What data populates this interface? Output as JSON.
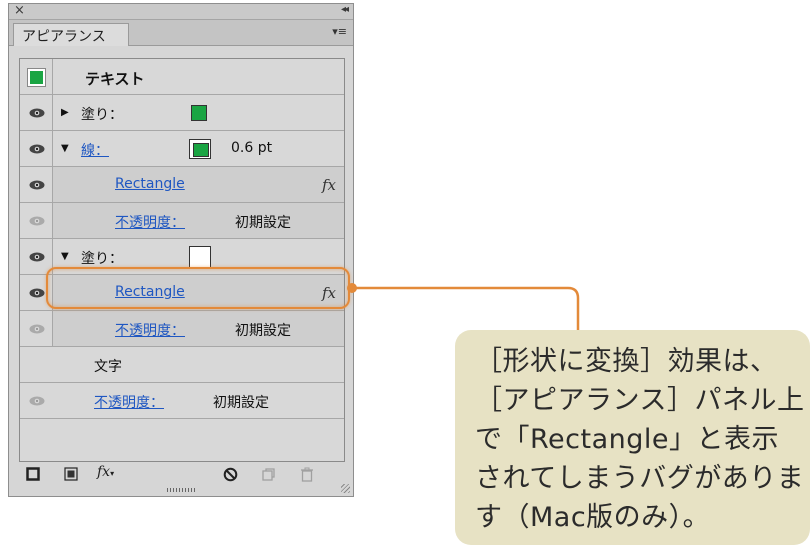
{
  "panel": {
    "tab_label": "アピアランス",
    "close_glyph": "×",
    "collapse_glyph": "◂◂",
    "menu_glyph": "▾≡"
  },
  "rows": {
    "header": {
      "label": "テキスト",
      "swatch_color": "#1aa543"
    },
    "fill1": {
      "label": "塗り：",
      "swatch_color": "#1aa543"
    },
    "stroke": {
      "label": "線：",
      "value": "0.6 pt",
      "swatch_color": "#1aa543"
    },
    "stroke_effect": {
      "label": "Rectangle",
      "fx": "fx"
    },
    "stroke_opacity": {
      "label": "不透明度：",
      "value": "初期設定"
    },
    "fill2": {
      "label": "塗り：",
      "swatch_color": "#ffffff"
    },
    "fill2_effect": {
      "label": "Rectangle",
      "fx": "fx"
    },
    "fill2_opacity": {
      "label": "不透明度：",
      "value": "初期設定"
    },
    "characters": {
      "label": "文字"
    },
    "text_opacity": {
      "label": "不透明度：",
      "value": "初期設定"
    }
  },
  "bottom_icons": [
    "square-icon",
    "filled-square-icon",
    "fx-menu-icon",
    "clear-icon",
    "duplicate-icon",
    "trash-icon"
  ],
  "callout": {
    "text": "［形状に変換］効果は、［アピアランス］パネル上で「Rectangle」と表示されてしまうバグがあります（Mac版のみ）。"
  },
  "colors": {
    "accent_orange": "#e38a3a",
    "link_blue": "#1f57c2",
    "callout_bg": "#e7e2c4",
    "swatch_green": "#1aa543"
  }
}
